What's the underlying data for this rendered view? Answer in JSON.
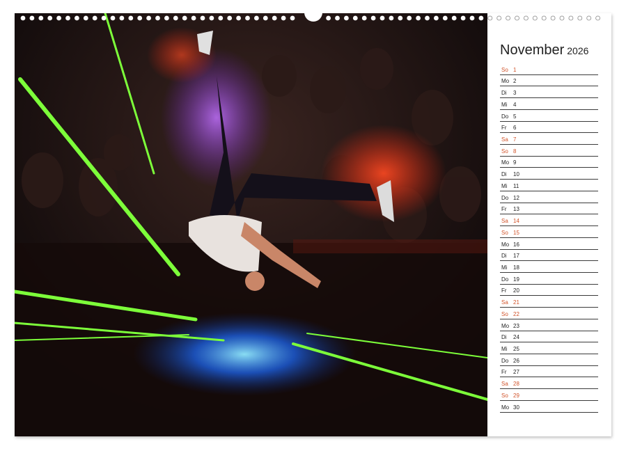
{
  "calendar": {
    "month": "November",
    "year": "2026",
    "weekend_color": "#d1532a",
    "days": [
      {
        "wd": "So",
        "d": "1",
        "weekend": true
      },
      {
        "wd": "Mo",
        "d": "2",
        "weekend": false
      },
      {
        "wd": "Di",
        "d": "3",
        "weekend": false
      },
      {
        "wd": "Mi",
        "d": "4",
        "weekend": false
      },
      {
        "wd": "Do",
        "d": "5",
        "weekend": false
      },
      {
        "wd": "Fr",
        "d": "6",
        "weekend": false
      },
      {
        "wd": "Sa",
        "d": "7",
        "weekend": true
      },
      {
        "wd": "So",
        "d": "8",
        "weekend": true
      },
      {
        "wd": "Mo",
        "d": "9",
        "weekend": false
      },
      {
        "wd": "Di",
        "d": "10",
        "weekend": false
      },
      {
        "wd": "Mi",
        "d": "11",
        "weekend": false
      },
      {
        "wd": "Do",
        "d": "12",
        "weekend": false
      },
      {
        "wd": "Fr",
        "d": "13",
        "weekend": false
      },
      {
        "wd": "Sa",
        "d": "14",
        "weekend": true
      },
      {
        "wd": "So",
        "d": "15",
        "weekend": true
      },
      {
        "wd": "Mo",
        "d": "16",
        "weekend": false
      },
      {
        "wd": "Di",
        "d": "17",
        "weekend": false
      },
      {
        "wd": "Mi",
        "d": "18",
        "weekend": false
      },
      {
        "wd": "Do",
        "d": "19",
        "weekend": false
      },
      {
        "wd": "Fr",
        "d": "20",
        "weekend": false
      },
      {
        "wd": "Sa",
        "d": "21",
        "weekend": true
      },
      {
        "wd": "So",
        "d": "22",
        "weekend": true
      },
      {
        "wd": "Mo",
        "d": "23",
        "weekend": false
      },
      {
        "wd": "Di",
        "d": "24",
        "weekend": false
      },
      {
        "wd": "Mi",
        "d": "25",
        "weekend": false
      },
      {
        "wd": "Do",
        "d": "26",
        "weekend": false
      },
      {
        "wd": "Fr",
        "d": "27",
        "weekend": false
      },
      {
        "wd": "Sa",
        "d": "28",
        "weekend": true
      },
      {
        "wd": "So",
        "d": "29",
        "weekend": true
      },
      {
        "wd": "Mo",
        "d": "30",
        "weekend": false
      }
    ]
  },
  "photo": {
    "subject": "breakdancer-headspin-photo",
    "palette": {
      "background": "#0b0708",
      "laser": "#6bff2e",
      "glow_blue": "#2a8cff",
      "glow_red": "#ff3a1e",
      "glow_purple": "#a04cff"
    }
  }
}
